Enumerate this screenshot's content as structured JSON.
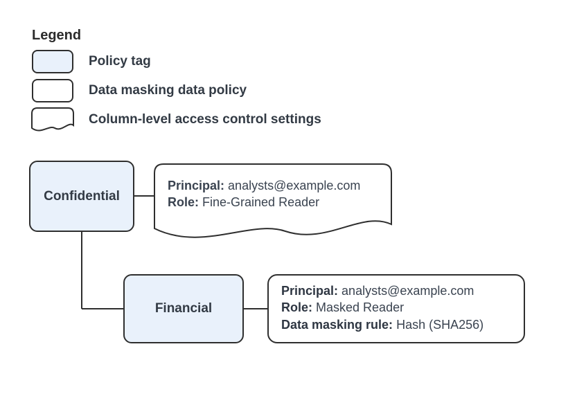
{
  "legend": {
    "title": "Legend",
    "items": [
      {
        "label": "Policy tag"
      },
      {
        "label": "Data masking data policy"
      },
      {
        "label": "Column-level access control settings"
      }
    ]
  },
  "colors": {
    "tag_fill": "#e9f1fb",
    "border": "#2e2e2e"
  },
  "nodes": {
    "confidential": {
      "label": "Confidential"
    },
    "financial": {
      "label": "Financial"
    }
  },
  "acl": {
    "principal_label": "Principal:",
    "principal_value": "analysts@example.com",
    "role_label": "Role:",
    "role_value": "Fine-Grained Reader"
  },
  "masking_policy": {
    "principal_label": "Principal:",
    "principal_value": "analysts@example.com",
    "role_label": "Role:",
    "role_value": "Masked Reader",
    "rule_label": "Data masking rule:",
    "rule_value": "Hash (SHA256)"
  }
}
